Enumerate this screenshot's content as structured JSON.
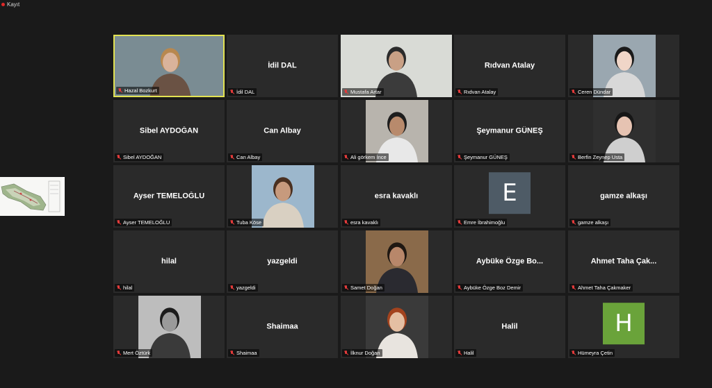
{
  "recording": {
    "label": "Kayıt"
  },
  "participants": [
    {
      "name": "Hazal Bozkurt",
      "tile": "",
      "kind": "video-full",
      "active": true
    },
    {
      "name": "İdil DAL",
      "tile": "İdil DAL",
      "kind": "name"
    },
    {
      "name": "Mustafa Artar",
      "tile": "",
      "kind": "video-full"
    },
    {
      "name": "Rıdvan Atalay",
      "tile": "Rıdvan Atalay",
      "kind": "name"
    },
    {
      "name": "Ceren Dündar",
      "tile": "",
      "kind": "video-center"
    },
    {
      "name": "Sibel AYDOĞAN",
      "tile": "Sibel AYDOĞAN",
      "kind": "name"
    },
    {
      "name": "Can Albay",
      "tile": "Can Albay",
      "kind": "name"
    },
    {
      "name": "Ali görkem İnce",
      "tile": "",
      "kind": "video-center"
    },
    {
      "name": "Şeymanur GÜNEŞ",
      "tile": "Şeymanur GÜNEŞ",
      "kind": "name"
    },
    {
      "name": "Berfin Zeynep Usta",
      "tile": "",
      "kind": "video-center"
    },
    {
      "name": "Ayser TEMELOĞLU",
      "tile": "Ayser TEMELOĞLU",
      "kind": "name"
    },
    {
      "name": "Tuba Köse",
      "tile": "",
      "kind": "video-center"
    },
    {
      "name": "esra kavaklı",
      "tile": "esra kavaklı",
      "kind": "name"
    },
    {
      "name": "Emre İbrahimoğlu",
      "tile": "",
      "kind": "avatar",
      "letter": "E",
      "color": "#4e5b66"
    },
    {
      "name": "gamze alkaşı",
      "tile": "gamze alkaşı",
      "kind": "name"
    },
    {
      "name": "hilal",
      "tile": "hilal",
      "kind": "name"
    },
    {
      "name": "yazgeldi",
      "tile": "yazgeldi",
      "kind": "name"
    },
    {
      "name": "Samet Doğan",
      "tile": "",
      "kind": "video-center"
    },
    {
      "name": "Aybüke Özge Boz Demir",
      "tile": "Aybüke Özge Bo...",
      "kind": "name"
    },
    {
      "name": "Ahmet Taha Çakmaker",
      "tile": "Ahmet Taha Çak...",
      "kind": "name"
    },
    {
      "name": "Mert Öztürk",
      "tile": "",
      "kind": "video-center"
    },
    {
      "name": "Shaimaa",
      "tile": "Shaimaa",
      "kind": "name"
    },
    {
      "name": "İlknur Doğan",
      "tile": "",
      "kind": "video-center"
    },
    {
      "name": "Halil",
      "tile": "Halil",
      "kind": "name"
    },
    {
      "name": "Hümeyra Çetin",
      "tile": "",
      "kind": "avatar",
      "letter": "H",
      "color": "#6aa33a"
    }
  ],
  "colors": {
    "active_border": "#e3e352",
    "tile_bg": "#2a2a2a",
    "muted_mic": "#e33b3b"
  },
  "icons": {
    "muted": "mic-muted-icon",
    "recording": "record-dot-icon"
  }
}
